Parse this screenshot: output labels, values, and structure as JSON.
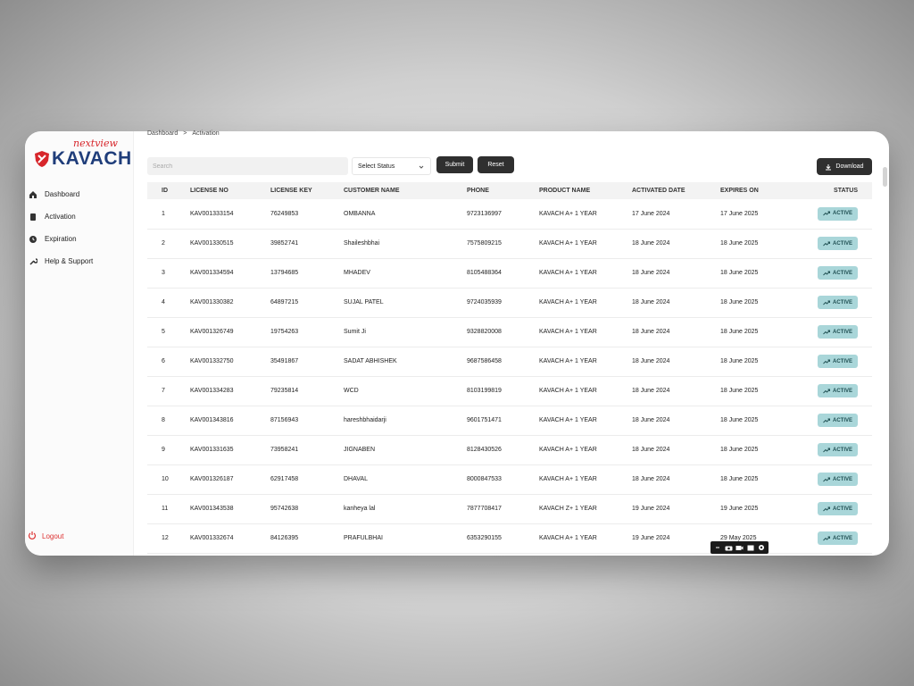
{
  "breadcrumb": {
    "root": "Dashboard",
    "separator": ">",
    "current": "Activation"
  },
  "brand": {
    "sub": "nextview",
    "name": "KAVACH"
  },
  "sidebar": {
    "items": [
      {
        "label": "Dashboard",
        "icon": "home-icon"
      },
      {
        "label": "Activation",
        "icon": "document-icon"
      },
      {
        "label": "Expiration",
        "icon": "clock-icon"
      },
      {
        "label": "Help & Support",
        "icon": "wrench-icon"
      }
    ],
    "logout": "Logout"
  },
  "toolbar": {
    "search_placeholder": "Search",
    "status_select": "Select Status",
    "submit": "Submit",
    "reset": "Reset",
    "download": "Download"
  },
  "table": {
    "headers": [
      "ID",
      "LICENSE NO",
      "LICENSE KEY",
      "CUSTOMER NAME",
      "PHONE",
      "PRODUCT NAME",
      "ACTIVATED DATE",
      "EXPIRES ON",
      "STATUS"
    ],
    "rows": [
      [
        "1",
        "KAV001333154",
        "76249853",
        "OMBANNA",
        "9723136997",
        "KAVACH A+ 1 YEAR",
        "17 June 2024",
        "17 June 2025",
        "ACTIVE"
      ],
      [
        "2",
        "KAV001330515",
        "39852741",
        "Shaileshbhai",
        "7575809215",
        "KAVACH A+ 1 YEAR",
        "18 June 2024",
        "18 June 2025",
        "ACTIVE"
      ],
      [
        "3",
        "KAV001334594",
        "13794685",
        "MHADEV",
        "8105488364",
        "KAVACH A+ 1 YEAR",
        "18 June 2024",
        "18 June 2025",
        "ACTIVE"
      ],
      [
        "4",
        "KAV001330382",
        "64897215",
        "SUJAL PATEL",
        "9724035939",
        "KAVACH A+ 1 YEAR",
        "18 June 2024",
        "18 June 2025",
        "ACTIVE"
      ],
      [
        "5",
        "KAV001326749",
        "19754263",
        "Sumit Ji",
        "9328820008",
        "KAVACH A+ 1 YEAR",
        "18 June 2024",
        "18 June 2025",
        "ACTIVE"
      ],
      [
        "6",
        "KAV001332750",
        "35491867",
        "SADAT ABHISHEK",
        "9687586458",
        "KAVACH A+ 1 YEAR",
        "18 June 2024",
        "18 June 2025",
        "ACTIVE"
      ],
      [
        "7",
        "KAV001334283",
        "79235814",
        "WCD",
        "8103199819",
        "KAVACH A+ 1 YEAR",
        "18 June 2024",
        "18 June 2025",
        "ACTIVE"
      ],
      [
        "8",
        "KAV001343816",
        "87156943",
        "hareshbhaidarji",
        "9601751471",
        "KAVACH A+ 1 YEAR",
        "18 June 2024",
        "18 June 2025",
        "ACTIVE"
      ],
      [
        "9",
        "KAV001331635",
        "73958241",
        "JIGNABEN",
        "8128430526",
        "KAVACH A+ 1 YEAR",
        "18 June 2024",
        "18 June 2025",
        "ACTIVE"
      ],
      [
        "10",
        "KAV001326187",
        "62917458",
        "DHAVAL",
        "8000847533",
        "KAVACH A+ 1 YEAR",
        "18 June 2024",
        "18 June 2025",
        "ACTIVE"
      ],
      [
        "11",
        "KAV001343538",
        "95742638",
        "kanheya lal",
        "7877708417",
        "KAVACH Z+ 1 YEAR",
        "19 June 2024",
        "19 June 2025",
        "ACTIVE"
      ],
      [
        "12",
        "KAV001332674",
        "84126395",
        "PRAFULBHAI",
        "6353290155",
        "KAVACH A+ 1 YEAR",
        "19 June 2024",
        "29 May 2025",
        "ACTIVE"
      ]
    ]
  },
  "colors": {
    "brand_red": "#d7262b",
    "brand_blue": "#1f3d7a",
    "badge_bg": "#a9d6d9",
    "button_dark": "#2f2f2f"
  }
}
